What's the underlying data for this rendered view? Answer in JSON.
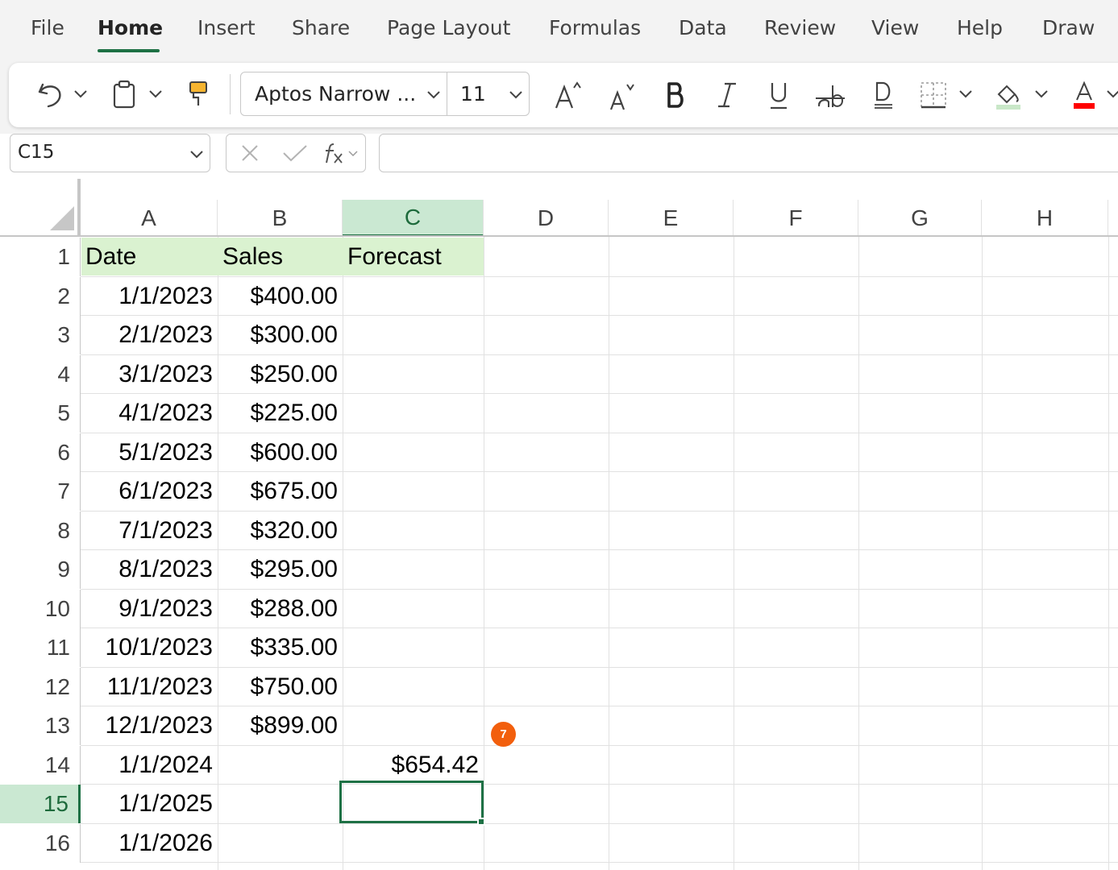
{
  "menu": {
    "tabs": [
      "File",
      "Home",
      "Insert",
      "Share",
      "Page Layout",
      "Formulas",
      "Data",
      "Review",
      "View",
      "Help",
      "Draw"
    ],
    "active": "Home"
  },
  "ribbon": {
    "font_name": "Aptos Narrow ...",
    "font_size": "11",
    "font_color": "#ff0000",
    "fill_color": "#c9e7c8",
    "icons": [
      "undo-icon",
      "clipboard-icon",
      "format-painter-icon",
      "increase-font-icon",
      "decrease-font-icon",
      "bold-icon",
      "italic-icon",
      "underline-icon",
      "strikethrough-icon",
      "double-underline-icon",
      "borders-icon",
      "fill-color-icon",
      "font-color-icon"
    ]
  },
  "formula_bar": {
    "name_box": "C15",
    "formula": ""
  },
  "grid": {
    "columns": [
      "A",
      "B",
      "C",
      "D",
      "E",
      "F",
      "G",
      "H"
    ],
    "selected_column": "C",
    "selected_row": "15",
    "headers": [
      "Date",
      "Sales",
      "Forecast"
    ],
    "rows": [
      {
        "n": "1",
        "a": "Date",
        "b": "Sales",
        "c": "Forecast"
      },
      {
        "n": "2",
        "a": "1/1/2023",
        "b": "$400.00",
        "c": ""
      },
      {
        "n": "3",
        "a": "2/1/2023",
        "b": "$300.00",
        "c": ""
      },
      {
        "n": "4",
        "a": "3/1/2023",
        "b": "$250.00",
        "c": ""
      },
      {
        "n": "5",
        "a": "4/1/2023",
        "b": "$225.00",
        "c": ""
      },
      {
        "n": "6",
        "a": "5/1/2023",
        "b": "$600.00",
        "c": ""
      },
      {
        "n": "7",
        "a": "6/1/2023",
        "b": "$675.00",
        "c": ""
      },
      {
        "n": "8",
        "a": "7/1/2023",
        "b": "$320.00",
        "c": ""
      },
      {
        "n": "9",
        "a": "8/1/2023",
        "b": "$295.00",
        "c": ""
      },
      {
        "n": "10",
        "a": "9/1/2023",
        "b": "$288.00",
        "c": ""
      },
      {
        "n": "11",
        "a": "10/1/2023",
        "b": "$335.00",
        "c": ""
      },
      {
        "n": "12",
        "a": "11/1/2023",
        "b": "$750.00",
        "c": ""
      },
      {
        "n": "13",
        "a": "12/1/2023",
        "b": "$899.00",
        "c": ""
      },
      {
        "n": "14",
        "a": "1/1/2024",
        "b": "",
        "c": "$654.42"
      },
      {
        "n": "15",
        "a": "1/1/2025",
        "b": "",
        "c": ""
      },
      {
        "n": "16",
        "a": "1/1/2026",
        "b": "",
        "c": ""
      }
    ],
    "header_fill_color": "#daf2d0",
    "selection_color": "#1e7145"
  },
  "badge": {
    "label": "7",
    "color": "#f25f0d"
  }
}
